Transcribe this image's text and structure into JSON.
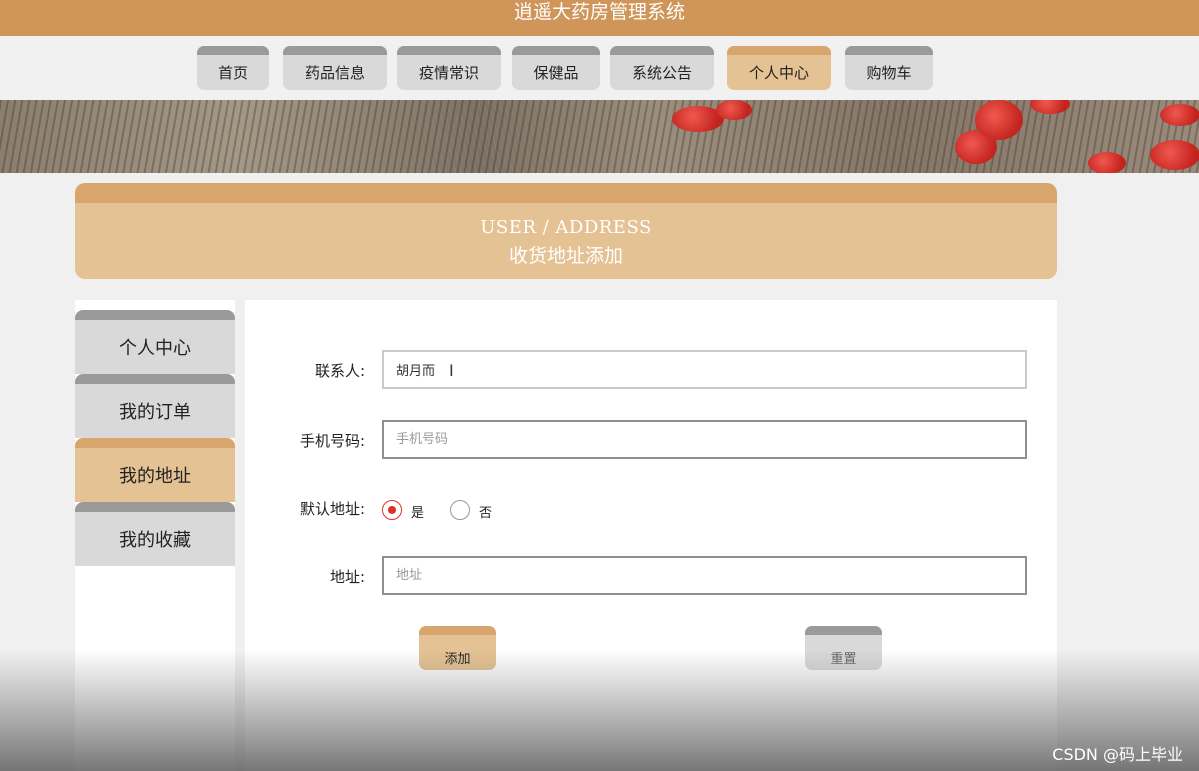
{
  "app": {
    "title": "逍遥大药房管理系统"
  },
  "nav": {
    "items": [
      {
        "label": "首页"
      },
      {
        "label": "药品信息"
      },
      {
        "label": "疫情常识"
      },
      {
        "label": "保健品"
      },
      {
        "label": "系统公告"
      },
      {
        "label": "个人中心"
      },
      {
        "label": "购物车"
      }
    ],
    "active": "个人中心"
  },
  "section": {
    "title_en": "USER / ADDRESS",
    "title_cn": "收货地址添加"
  },
  "sidebar": {
    "items": [
      {
        "label": "个人中心"
      },
      {
        "label": "我的订单"
      },
      {
        "label": "我的地址"
      },
      {
        "label": "我的收藏"
      }
    ],
    "active": "我的地址"
  },
  "form": {
    "contact": {
      "label": "联系人:",
      "value": "胡月而"
    },
    "phone": {
      "label": "手机号码:",
      "value": "",
      "placeholder": "手机号码"
    },
    "default": {
      "label": "默认地址:",
      "options": [
        "是",
        "否"
      ],
      "selected": "是"
    },
    "address": {
      "label": "地址:",
      "value": "",
      "placeholder": "地址"
    },
    "add_label": "添加",
    "reset_label": "重置"
  },
  "watermark": "CSDN @码上毕业",
  "colors": {
    "title_bar": "#cf9559",
    "accent": "#e4c293",
    "accent_top": "#d8a66d",
    "tab_gray": "#d9d9d9",
    "tab_gray_top": "#9a9a9a",
    "radio_checked": "#e0302c"
  }
}
